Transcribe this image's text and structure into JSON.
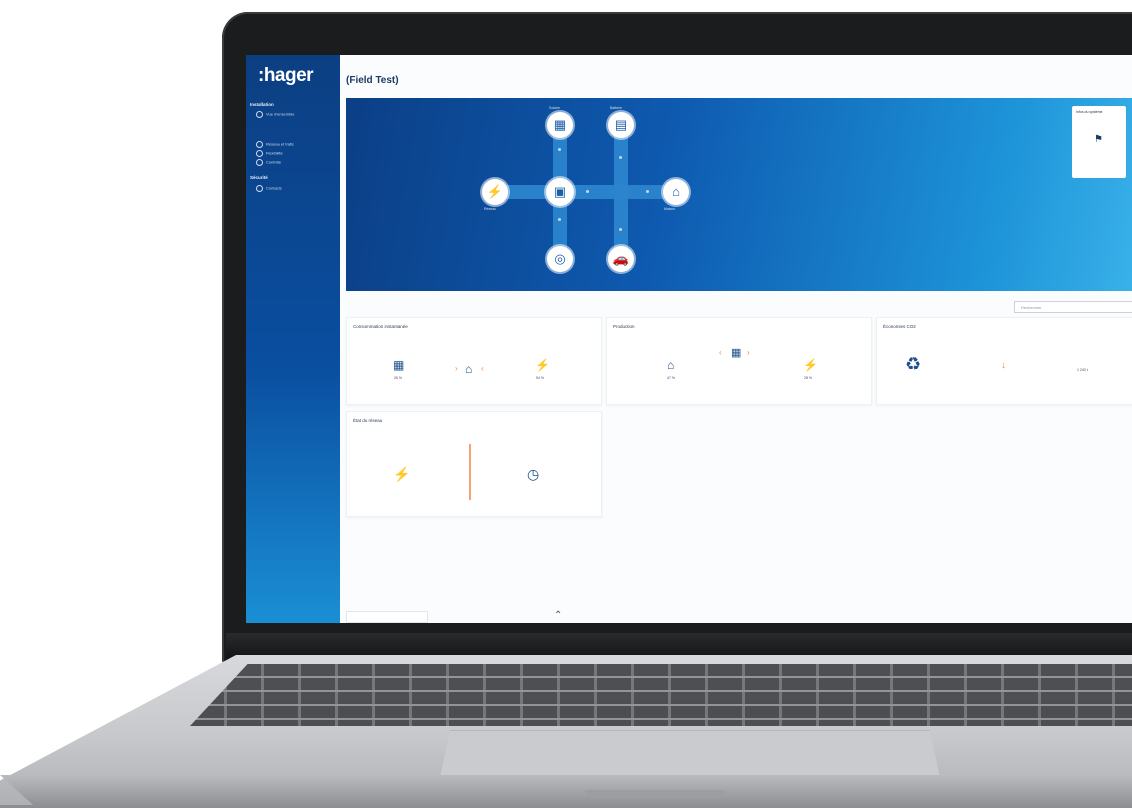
{
  "app": {
    "brand": ":hager",
    "page_title": "(Field Test)"
  },
  "sidebar": {
    "sections": [
      {
        "label": "Installation",
        "items": [
          "Vue d'ensemble"
        ]
      },
      {
        "label": "",
        "items": [
          "Réseau et trafic",
          "Flexibilité",
          "Contrôle"
        ]
      },
      {
        "label": "Sécurité",
        "items": [
          "Contacts"
        ]
      }
    ]
  },
  "hero": {
    "nodes": [
      {
        "name": "solar",
        "icon": "solar-panel-icon",
        "glyph": "▦",
        "label": "Solaire"
      },
      {
        "name": "battery",
        "icon": "battery-icon",
        "glyph": "▤",
        "label": "Batterie"
      },
      {
        "name": "grid",
        "icon": "pylon-icon",
        "glyph": "⚡",
        "label": "Réseau"
      },
      {
        "name": "hub",
        "icon": "hub-icon",
        "glyph": "▣",
        "label": ""
      },
      {
        "name": "house",
        "icon": "house-icon",
        "glyph": "⌂",
        "label": "Maison"
      },
      {
        "name": "ev",
        "icon": "ev-charger-icon",
        "glyph": "◎",
        "label": ""
      },
      {
        "name": "car",
        "icon": "car-icon",
        "glyph": "🚗",
        "label": ""
      }
    ],
    "side_card": {
      "title": "Infos du système",
      "icon": "flag-icon"
    }
  },
  "search": {
    "placeholder": "Rechercher"
  },
  "panels": {
    "consumption": {
      "title": "Consommation instantanée",
      "left_value": "26 %",
      "right_value": "54 %"
    },
    "production": {
      "title": "Production",
      "left_value": "47 %",
      "right_value": "28 %"
    },
    "autarky": {
      "title": "Économies CO2",
      "right_value": "1 240 t"
    },
    "grid_state": {
      "title": "État du réseau"
    }
  },
  "colors": {
    "sidebar_top": "#0c3f82",
    "hero_start": "#0b3f86",
    "hero_end": "#3bb3ea",
    "accent_orange": "#f08a3c",
    "icon_blue": "#1d4f8f"
  }
}
